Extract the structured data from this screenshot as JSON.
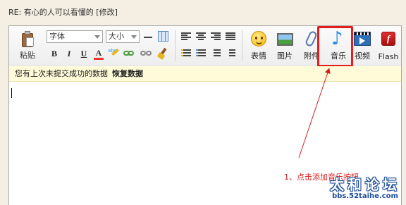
{
  "thread_title": "RE: 有心的人可以看懂的 [修改]",
  "toolbar": {
    "paste_label": "粘贴",
    "font_select": "字体",
    "size_select": "大小",
    "bold": "B",
    "italic": "I",
    "underline": "U",
    "text_color": "A",
    "highlight_text": "abc",
    "emoticon_label": "表情",
    "image_label": "图片",
    "attachment_label": "附件",
    "music_label": "音乐",
    "video_label": "视频",
    "flash_label": "Flash",
    "flash_glyph": "f",
    "music_glyph": "♪"
  },
  "notice": {
    "text": "您有上次未提交成功的数据",
    "restore_label": "恢复数据"
  },
  "annotation": {
    "text": "1、点击添加音乐按钮",
    "color": "#d71e1e"
  },
  "watermark": {
    "title": "太和论坛",
    "url": "bbs.52taihe.com"
  },
  "colors": {
    "highlight_box": "#e51c1c",
    "background": "#f5efe3"
  }
}
